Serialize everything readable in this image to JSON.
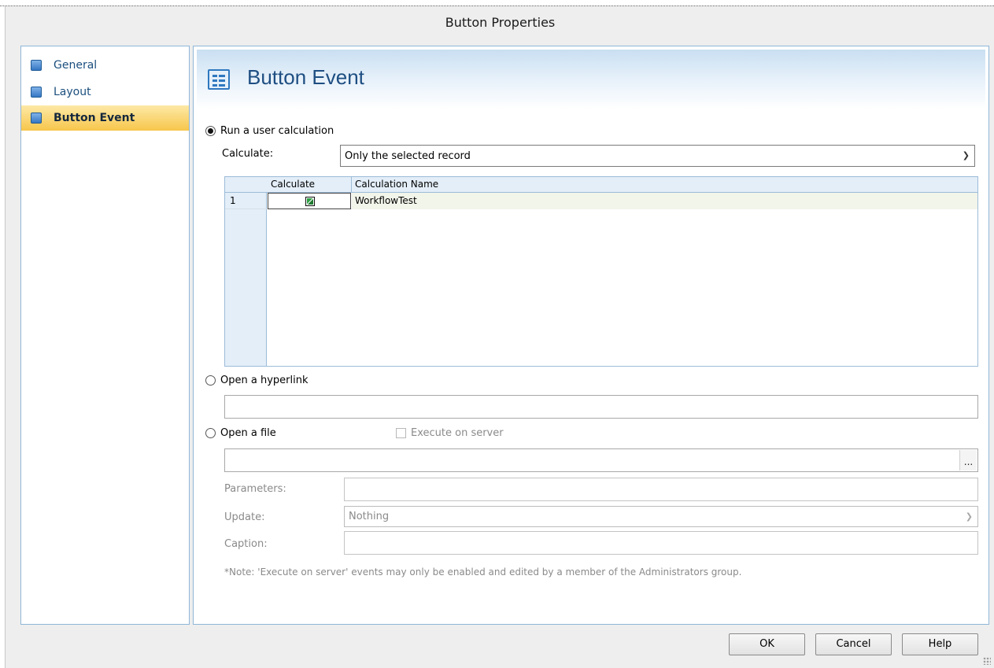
{
  "window": {
    "title": "Button Properties"
  },
  "nav": {
    "items": [
      {
        "label": "General",
        "active": false
      },
      {
        "label": "Layout",
        "active": false
      },
      {
        "label": "Button Event",
        "active": true
      }
    ]
  },
  "header": {
    "title": "Button Event"
  },
  "run_calc": {
    "label": "Run a user calculation",
    "selected": true,
    "calculate_label": "Calculate:",
    "calculate_value": "Only the selected record"
  },
  "grid": {
    "columns": [
      "Calculate",
      "Calculation Name"
    ],
    "rows": [
      {
        "num": "1",
        "checked": true,
        "name": "WorkflowTest"
      }
    ]
  },
  "hyperlink": {
    "label": "Open a hyperlink",
    "selected": false,
    "value": ""
  },
  "open_file": {
    "label": "Open a file",
    "selected": false,
    "execute_label": "Execute on server",
    "execute_checked": false,
    "path_value": "",
    "browse_label": "...",
    "parameters_label": "Parameters:",
    "update_label": "Update:",
    "update_value": "Nothing",
    "caption_label": "Caption:"
  },
  "note": "*Note: 'Execute on server' events may only be enabled and edited by a member of the Administrators group.",
  "buttons": {
    "ok": "OK",
    "cancel": "Cancel",
    "help": "Help"
  },
  "colors": {
    "accent": "#1e4e82",
    "active_nav": "#f7c64b",
    "panel_border": "#8fb6d8"
  }
}
